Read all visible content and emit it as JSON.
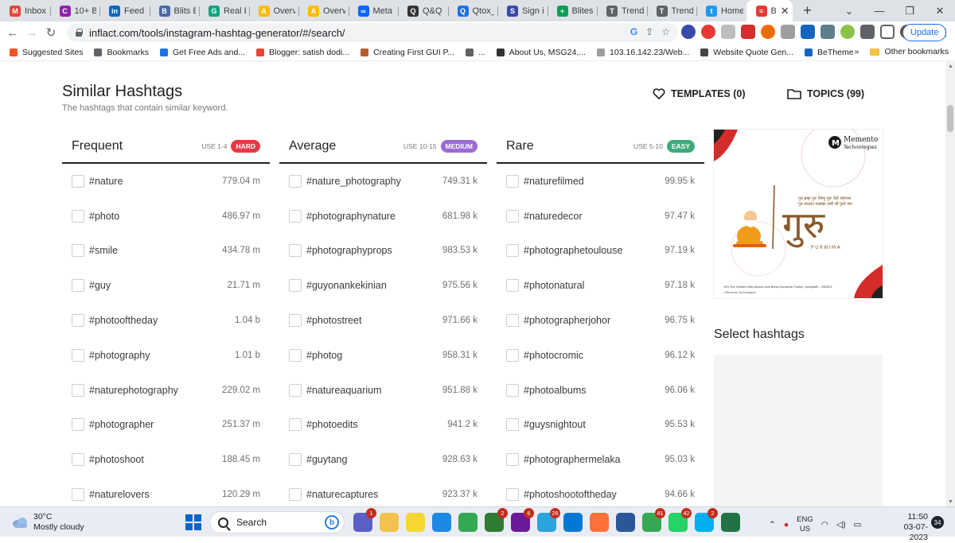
{
  "browser": {
    "tabs": [
      {
        "label": "Inbox (",
        "color": "#ea4335",
        "glyph": "M"
      },
      {
        "label": "10+ Be",
        "color": "#8e24aa",
        "glyph": "C"
      },
      {
        "label": "Feed |",
        "color": "#0a66c2",
        "glyph": "in"
      },
      {
        "label": "Blits Es",
        "color": "#4a6aa5",
        "glyph": "B"
      },
      {
        "label": "Real Es",
        "color": "#10a37f",
        "glyph": "G"
      },
      {
        "label": "Overvie",
        "color": "#fbbc04",
        "glyph": "A"
      },
      {
        "label": "Overvie",
        "color": "#fbbc04",
        "glyph": "A"
      },
      {
        "label": "Meta B",
        "color": "#0866ff",
        "glyph": "∞"
      },
      {
        "label": "Q&Q |",
        "color": "#333333",
        "glyph": "Q"
      },
      {
        "label": "Qtox_C",
        "color": "#1a73e8",
        "glyph": "Q"
      },
      {
        "label": "Sign in",
        "color": "#3949ab",
        "glyph": "S"
      },
      {
        "label": "Blites E",
        "color": "#0f9d58",
        "glyph": "+"
      },
      {
        "label": "TrendB",
        "color": "#5f6368",
        "glyph": "T"
      },
      {
        "label": "TrendB",
        "color": "#5f6368",
        "glyph": "T"
      },
      {
        "label": "Home",
        "color": "#1d9bf0",
        "glyph": "t"
      },
      {
        "label": "Bes",
        "color": "#e53935",
        "glyph": "≡"
      }
    ],
    "active_tab_index": 15,
    "new_tab_glyph": "+",
    "close_glyph": "✕",
    "window_controls": [
      "⌄",
      "—",
      "❐",
      "✕"
    ],
    "url": "inflact.com/tools/instagram-hashtag-generator/#/search/",
    "update_label": "Update",
    "bookmarks": [
      {
        "label": "Suggested Sites",
        "color": "#f4511e"
      },
      {
        "label": "Bookmarks",
        "color": "#5f6368"
      },
      {
        "label": "Get Free Ads and...",
        "color": "#1a73e8"
      },
      {
        "label": "Blogger: satish dodi...",
        "color": "#ea4335"
      },
      {
        "label": "Creating First GUI P...",
        "color": "#b85c2b"
      },
      {
        "label": "...",
        "color": "#5f6368"
      },
      {
        "label": "About Us, MSG24,...",
        "color": "#333333"
      },
      {
        "label": "103.16.142.23/Web...",
        "color": "#9e9e9e"
      },
      {
        "label": "Website Quote Gen...",
        "color": "#444444"
      },
      {
        "label": "BeTheme",
        "color": "#1565c0"
      }
    ],
    "overflow_label": "»",
    "other_bookmarks": "Other bookmarks"
  },
  "page": {
    "title": "Similar Hashtags",
    "subtitle": "The hashtags that contain similar keyword.",
    "templates_label": "TEMPLATES (0)",
    "topics_label": "TOPICS (99)",
    "select_title": "Select hashtags",
    "columns": [
      {
        "title": "Frequent",
        "use": "USE 1-4",
        "badge": "HARD",
        "badge_color": "#e53945",
        "rows": [
          {
            "tag": "#nature",
            "count": "779.04 m"
          },
          {
            "tag": "#photo",
            "count": "486.97 m"
          },
          {
            "tag": "#smile",
            "count": "434.78 m"
          },
          {
            "tag": "#guy",
            "count": "21.71 m"
          },
          {
            "tag": "#photooftheday",
            "count": "1.04 b"
          },
          {
            "tag": "#photography",
            "count": "1.01 b"
          },
          {
            "tag": "#naturephotography",
            "count": "229.02 m"
          },
          {
            "tag": "#photographer",
            "count": "251.37 m"
          },
          {
            "tag": "#photoshoot",
            "count": "188.45 m"
          },
          {
            "tag": "#naturelovers",
            "count": "120.29 m"
          }
        ]
      },
      {
        "title": "Average",
        "use": "USE 10-15",
        "badge": "MEDIUM",
        "badge_color": "#9c6ad6",
        "rows": [
          {
            "tag": "#nature_photography",
            "count": "749.31 k"
          },
          {
            "tag": "#photographynature",
            "count": "681.98 k"
          },
          {
            "tag": "#photographyprops",
            "count": "983.53 k"
          },
          {
            "tag": "#guyonankekinian",
            "count": "975.56 k"
          },
          {
            "tag": "#photostreet",
            "count": "971.66 k"
          },
          {
            "tag": "#photog",
            "count": "958.31 k"
          },
          {
            "tag": "#natureaquarium",
            "count": "951.88 k"
          },
          {
            "tag": "#photoedits",
            "count": "941.2 k"
          },
          {
            "tag": "#guytang",
            "count": "928.63 k"
          },
          {
            "tag": "#naturecaptures",
            "count": "923.37 k"
          }
        ]
      },
      {
        "title": "Rare",
        "use": "USE 5-10",
        "badge": "EASY",
        "badge_color": "#3dab7a",
        "rows": [
          {
            "tag": "#naturefilmed",
            "count": "99.95 k"
          },
          {
            "tag": "#naturedecor",
            "count": "97.47 k"
          },
          {
            "tag": "#photographetoulouse",
            "count": "97.19 k"
          },
          {
            "tag": "#photonatural",
            "count": "97.18 k"
          },
          {
            "tag": "#photographerjohor",
            "count": "96.75 k"
          },
          {
            "tag": "#photocromic",
            "count": "96.12 k"
          },
          {
            "tag": "#photoalbums",
            "count": "96.06 k"
          },
          {
            "tag": "#guysnightout",
            "count": "95.53 k"
          },
          {
            "tag": "#photographermelaka",
            "count": "95.03 k"
          },
          {
            "tag": "#photoshootoftheday",
            "count": "94.66 k"
          }
        ]
      }
    ],
    "ad": {
      "brand": "Memento",
      "brand_sub": "Technologies",
      "word": "गुरु",
      "word_sub": "PURNIMA",
      "shlok_1": "गुरु ब्रम्हा गुरु विष्णु गुरुः देवो महेश्वरा",
      "shlok_2": "गुरु साक्षात परब्रम्हा तस्मै श्री गुरवे नमः",
      "address": "105,The Garden Islet,Above Axis Bank,Zanzarda Chokdi ,Junagadh - 362001",
      "footer": "/ Memento Technologies"
    }
  },
  "taskbar": {
    "temp": "30°C",
    "condition": "Mostly cloudy",
    "search_label": "Search",
    "apps": [
      {
        "name": "meet-app",
        "color": "#5b5fc7",
        "badge": "1"
      },
      {
        "name": "file-explorer",
        "color": "#f2c14e",
        "badge": ""
      },
      {
        "name": "sticky-notes",
        "color": "#f7d631",
        "badge": ""
      },
      {
        "name": "vscode",
        "color": "#1e88e5",
        "badge": ""
      },
      {
        "name": "chrome",
        "color": "#34a853",
        "badge": ""
      },
      {
        "name": "project-app",
        "color": "#2e7d32",
        "badge": "2"
      },
      {
        "name": "chrome-profile-2",
        "color": "#6a1b9a",
        "badge": "6"
      },
      {
        "name": "telegram",
        "color": "#2aa3df",
        "badge": "26"
      },
      {
        "name": "photos",
        "color": "#0078d4",
        "badge": ""
      },
      {
        "name": "firefox",
        "color": "#ff7139",
        "badge": ""
      },
      {
        "name": "word",
        "color": "#2b579a",
        "badge": ""
      },
      {
        "name": "chrome-profile-3",
        "color": "#34a853",
        "badge": "41"
      },
      {
        "name": "whatsapp",
        "color": "#25d366",
        "badge": "42"
      },
      {
        "name": "skype",
        "color": "#00aff0",
        "badge": "2"
      },
      {
        "name": "excel",
        "color": "#217346",
        "badge": ""
      }
    ],
    "lang_1": "ENG",
    "lang_2": "US",
    "time": "11:50",
    "date": "03-07-2023",
    "notif_count": "34"
  }
}
